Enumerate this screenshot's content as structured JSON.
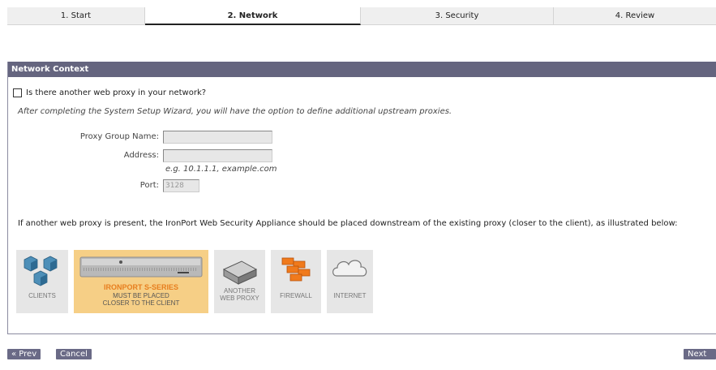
{
  "wizard": {
    "steps": [
      {
        "label": "1. Start"
      },
      {
        "label": "2. Network"
      },
      {
        "label": "3. Security"
      },
      {
        "label": "4. Review"
      }
    ],
    "active_step": 2
  },
  "panel": {
    "title": "Network Context",
    "question": "Is there another web proxy in your network?",
    "question_checked": false,
    "note": "After completing the System Setup Wizard, you will have the option to define additional upstream proxies.",
    "fields": {
      "group_name_label": "Proxy Group Name:",
      "group_name_value": "",
      "address_label": "Address:",
      "address_value": "",
      "address_hint": "e.g. 10.1.1.1, example.com",
      "port_label": "Port:",
      "port_value": "3128"
    },
    "description": "If another web proxy is present, the IronPort Web Security Appliance should be placed downstream of the existing proxy (closer to the client), as illustrated below:"
  },
  "diagram": {
    "clients_label": "CLIENTS",
    "ironport_title": "IRONPORT S-SERIES",
    "ironport_line1": "MUST BE PLACED",
    "ironport_line2": "CLOSER TO THE CLIENT",
    "proxy_line1": "ANOTHER",
    "proxy_line2": "WEB PROXY",
    "firewall_label": "FIREWALL",
    "internet_label": "INTERNET"
  },
  "buttons": {
    "prev": "« Prev",
    "cancel": "Cancel",
    "next": "Next »"
  },
  "colors": {
    "header_bg": "#65657f",
    "button_bg": "#6a6a86",
    "ironport_tile": "#f6cf86",
    "ironport_text": "#e77e1e"
  }
}
